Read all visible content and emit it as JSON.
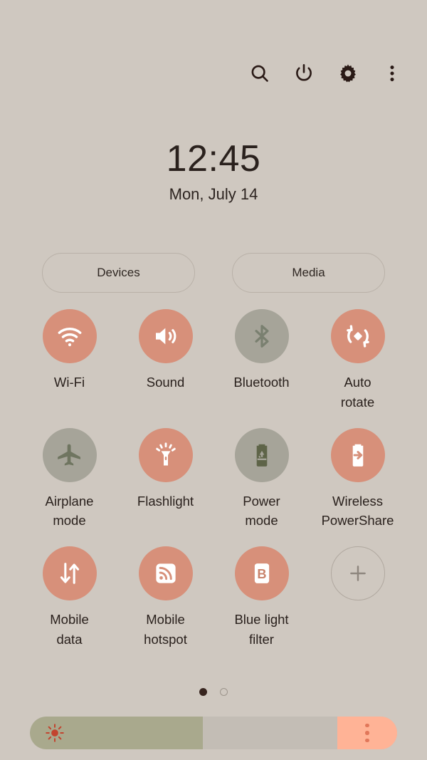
{
  "statusbar": {
    "icons": [
      {
        "name": "search-icon",
        "label": "Search"
      },
      {
        "name": "power-icon",
        "label": "Power off"
      },
      {
        "name": "gear-icon",
        "label": "Settings"
      },
      {
        "name": "overflow-menu-icon",
        "label": "More options"
      }
    ]
  },
  "clock": {
    "time": "12:45",
    "date": "Mon, July 14"
  },
  "pills": [
    {
      "label": "Devices"
    },
    {
      "label": "Media"
    }
  ],
  "tiles": [
    {
      "label": "Wi-Fi",
      "icon": "wifi-icon",
      "state": "on"
    },
    {
      "label": "Sound",
      "icon": "volume-icon",
      "state": "on"
    },
    {
      "label": "Bluetooth",
      "icon": "bluetooth-icon",
      "state": "off"
    },
    {
      "label": "Auto\nrotate",
      "icon": "auto-rotate-icon",
      "state": "on"
    },
    {
      "label": "Airplane\nmode",
      "icon": "airplane-icon",
      "state": "off"
    },
    {
      "label": "Flashlight",
      "icon": "flashlight-icon",
      "state": "on"
    },
    {
      "label": "Power\nmode",
      "icon": "power-mode-icon",
      "state": "off"
    },
    {
      "label": "Wireless\nPowerShare",
      "icon": "power-share-icon",
      "state": "on"
    },
    {
      "label": "Mobile\ndata",
      "icon": "mobile-data-icon",
      "state": "on"
    },
    {
      "label": "Mobile\nhotspot",
      "icon": "hotspot-icon",
      "state": "on"
    },
    {
      "label": "Blue light\nfilter",
      "icon": "blue-light-filter-icon",
      "state": "on"
    },
    {
      "label": "",
      "icon": "plus-icon",
      "state": "add"
    }
  ],
  "pager": {
    "pages": 2,
    "current": 1
  },
  "brightness": {
    "value_percent": 47,
    "sun_icon": "brightness-sun-icon",
    "menu_icon": "brightness-options-icon"
  },
  "colors": {
    "background": "#cfc8c0",
    "tile_on": "#d7907a",
    "tile_off": "#a6a499",
    "slider_fill": "#a9a98d",
    "slider_track": "#c3bdb5",
    "slider_menu": "#ffb396",
    "text": "#2a211d"
  }
}
